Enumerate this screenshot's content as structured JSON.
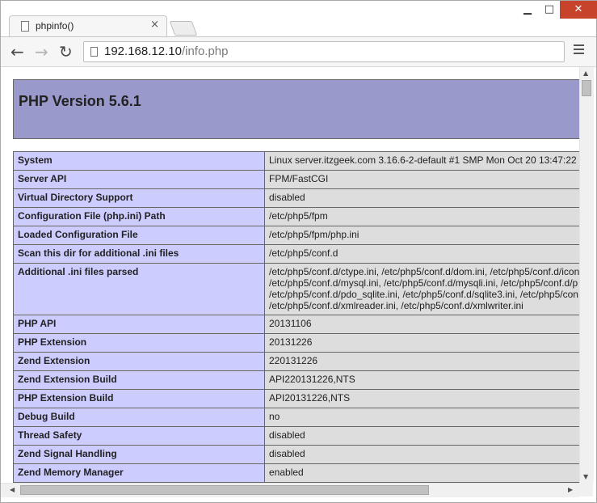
{
  "browser": {
    "tab_title": "phpinfo()",
    "tab_close": "×",
    "window_controls": {
      "minimize": "▁",
      "maximize": "□",
      "close": "✕"
    },
    "url_host": "192.168.12.10",
    "url_path": "/info.php",
    "nav": {
      "back": "←",
      "forward": "→",
      "reload": "↻"
    }
  },
  "page": {
    "title": "PHP Version 5.6.1",
    "rows": [
      {
        "label": "System",
        "value": [
          "Linux server.itzgeek.com 3.16.6-2-default #1 SMP Mon Oct 20 13:47:22"
        ]
      },
      {
        "label": "Server API",
        "value": [
          "FPM/FastCGI"
        ]
      },
      {
        "label": "Virtual Directory Support",
        "value": [
          "disabled"
        ]
      },
      {
        "label": "Configuration File (php.ini) Path",
        "value": [
          "/etc/php5/fpm"
        ]
      },
      {
        "label": "Loaded Configuration File",
        "value": [
          "/etc/php5/fpm/php.ini"
        ]
      },
      {
        "label": "Scan this dir for additional .ini files",
        "value": [
          "/etc/php5/conf.d"
        ]
      },
      {
        "label": "Additional .ini files parsed",
        "value": [
          "/etc/php5/conf.d/ctype.ini, /etc/php5/conf.d/dom.ini, /etc/php5/conf.d/icon",
          "/etc/php5/conf.d/mysql.ini, /etc/php5/conf.d/mysqli.ini, /etc/php5/conf.d/p",
          "/etc/php5/conf.d/pdo_sqlite.ini, /etc/php5/conf.d/sqlite3.ini, /etc/php5/con",
          "/etc/php5/conf.d/xmlreader.ini, /etc/php5/conf.d/xmlwriter.ini"
        ]
      },
      {
        "label": "PHP API",
        "value": [
          "20131106"
        ]
      },
      {
        "label": "PHP Extension",
        "value": [
          "20131226"
        ]
      },
      {
        "label": "Zend Extension",
        "value": [
          "220131226"
        ]
      },
      {
        "label": "Zend Extension Build",
        "value": [
          "API220131226,NTS"
        ]
      },
      {
        "label": "PHP Extension Build",
        "value": [
          "API20131226,NTS"
        ]
      },
      {
        "label": "Debug Build",
        "value": [
          "no"
        ]
      },
      {
        "label": "Thread Safety",
        "value": [
          "disabled"
        ]
      },
      {
        "label": "Zend Signal Handling",
        "value": [
          "disabled"
        ]
      },
      {
        "label": "Zend Memory Manager",
        "value": [
          "enabled"
        ]
      }
    ]
  },
  "colors": {
    "header_bg": "#9999cc",
    "label_bg": "#ccccff",
    "value_bg": "#dddddd",
    "close_button": "#c7432c"
  },
  "icons": {
    "favicon": "page-icon",
    "menu": "hamburger-menu-icon"
  }
}
